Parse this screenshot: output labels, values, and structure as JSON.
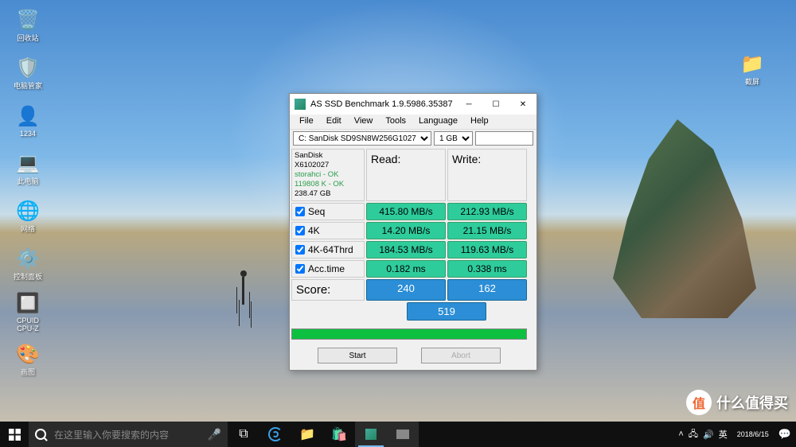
{
  "desktop_icons_left": [
    {
      "name": "recycle-bin",
      "glyph": "🗑️",
      "label": "回收站"
    },
    {
      "name": "computer-manager",
      "glyph": "🛡️",
      "label": "电脑管家"
    },
    {
      "name": "user-folder",
      "glyph": "👤",
      "label": "1234"
    },
    {
      "name": "this-pc",
      "glyph": "💻",
      "label": "此电脑"
    },
    {
      "name": "network",
      "glyph": "🌐",
      "label": "网络"
    },
    {
      "name": "control-panel",
      "glyph": "⚙️",
      "label": "控制面板"
    },
    {
      "name": "cpu-z",
      "glyph": "🔲",
      "label": "CPUID\nCPU-Z"
    },
    {
      "name": "paint",
      "glyph": "🎨",
      "label": "画图"
    }
  ],
  "desktop_icons_right": [
    {
      "name": "screenshot-folder",
      "glyph": "📁",
      "label": "截屏"
    }
  ],
  "window": {
    "title": "AS SSD Benchmark 1.9.5986.35387",
    "menu": [
      "File",
      "Edit",
      "View",
      "Tools",
      "Language",
      "Help"
    ],
    "drive_select": "C: SanDisk SD9SN8W256G1027",
    "size_select": "1 GB",
    "info": {
      "line1": "SanDisk",
      "line2": "X6102027",
      "line3": "storahci - OK",
      "line4": "119808 K - OK",
      "line5": "238.47 GB"
    },
    "headers": {
      "read": "Read:",
      "write": "Write:"
    },
    "rows": [
      {
        "label": "Seq",
        "read": "415.80 MB/s",
        "write": "212.93 MB/s"
      },
      {
        "label": "4K",
        "read": "14.20 MB/s",
        "write": "21.15 MB/s"
      },
      {
        "label": "4K-64Thrd",
        "read": "184.53 MB/s",
        "write": "119.63 MB/s"
      },
      {
        "label": "Acc.time",
        "read": "0.182 ms",
        "write": "0.338 ms"
      }
    ],
    "score_label": "Score:",
    "score_read": "240",
    "score_write": "162",
    "score_total": "519",
    "btn_start": "Start",
    "btn_abort": "Abort"
  },
  "taskbar": {
    "search_placeholder": "在这里输入你要搜索的内容",
    "date": "2018/6/15"
  },
  "watermark": {
    "badge": "值",
    "text": "什么值得买"
  }
}
